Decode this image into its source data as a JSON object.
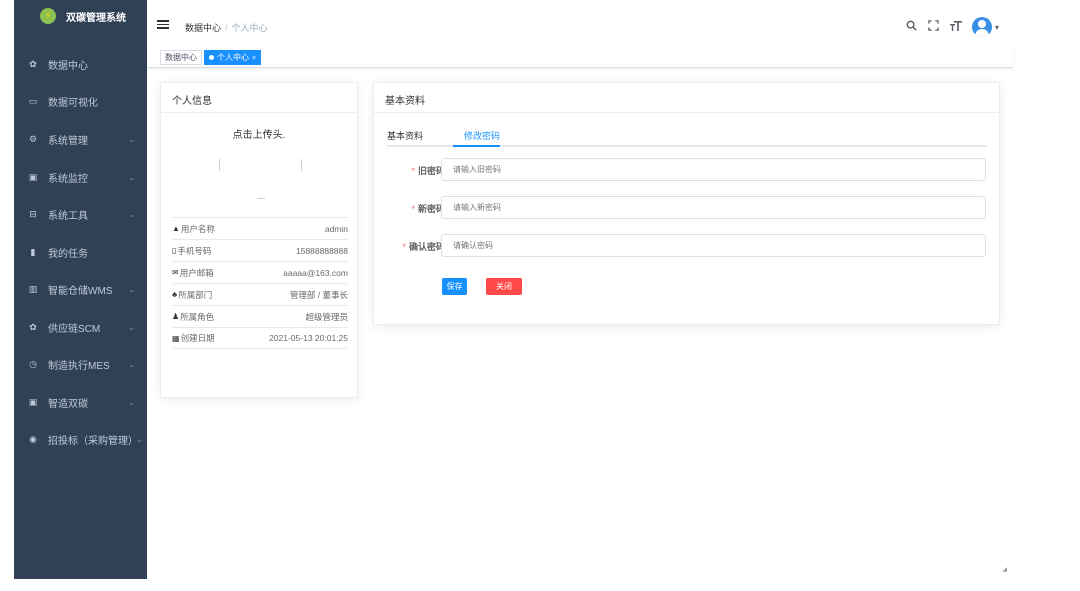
{
  "app": {
    "title": "双碳管理系统"
  },
  "sidebar": {
    "items": [
      {
        "label": "数据中心",
        "icon": "dashboard-icon",
        "glyph": "✿",
        "arrow": ""
      },
      {
        "label": "数据可视化",
        "icon": "monitor-icon",
        "glyph": "▭",
        "arrow": ""
      },
      {
        "label": "系统管理",
        "icon": "gear-icon",
        "glyph": "⚙",
        "arrow": "⌄"
      },
      {
        "label": "系统监控",
        "icon": "screen-icon",
        "glyph": "▣",
        "arrow": "⌄"
      },
      {
        "label": "系统工具",
        "icon": "toolbox-icon",
        "glyph": "⊟",
        "arrow": "⌄"
      },
      {
        "label": "我的任务",
        "icon": "task-icon",
        "glyph": "▮",
        "arrow": ""
      },
      {
        "label": "智能仓储WMS",
        "icon": "chart-icon",
        "glyph": "▥",
        "arrow": "⌄"
      },
      {
        "label": "供应链SCM",
        "icon": "dashboard-icon",
        "glyph": "✿",
        "arrow": "⌄"
      },
      {
        "label": "制造执行MES",
        "icon": "clock-icon",
        "glyph": "◷",
        "arrow": "⌄"
      },
      {
        "label": "智造双碳",
        "icon": "screen-icon",
        "glyph": "▣",
        "arrow": "⌄"
      },
      {
        "label": "招投标（采购管理）",
        "icon": "globe-icon",
        "glyph": "◉",
        "arrow": "⌄"
      }
    ]
  },
  "navbar": {
    "breadcrumb": [
      "数据中心",
      "个人中心"
    ],
    "separator": "/"
  },
  "tags": [
    {
      "label": "数据中心",
      "active": false
    },
    {
      "label": "个人中心",
      "active": true,
      "close": "×"
    }
  ],
  "info_card": {
    "title": "个人信息",
    "upload_text": "点击上传头.",
    "rows": [
      {
        "label": "用户名称",
        "value": "admin",
        "icon": "user-icon",
        "glyph": "👤"
      },
      {
        "label": "手机号码",
        "value": "15888888888",
        "icon": "phone-icon",
        "glyph": "▯"
      },
      {
        "label": "用户邮箱",
        "value": "aaaaa@163.com",
        "icon": "mail-icon",
        "glyph": "✉"
      },
      {
        "label": "所属部门",
        "value": "管理部 / 董事长",
        "icon": "tree-icon",
        "glyph": "品"
      },
      {
        "label": "所属角色",
        "value": "超级管理员",
        "icon": "peoples-icon",
        "glyph": "👥"
      },
      {
        "label": "创建日期",
        "value": "2021-05-13 20:01:25",
        "icon": "date-icon",
        "glyph": "▦"
      }
    ]
  },
  "basic_card": {
    "title": "基本资料",
    "tabs": [
      "基本资料",
      "修改密码"
    ],
    "active_tab": 1,
    "fields": [
      {
        "label": "旧密码",
        "placeholder": "请输入旧密码",
        "value": ""
      },
      {
        "label": "新密码",
        "placeholder": "请输入新密码",
        "value": ""
      },
      {
        "label": "确认密码",
        "placeholder": "请确认密码",
        "value": ""
      }
    ],
    "required_mark": "*",
    "save_label": "保存",
    "close_label": "关闭"
  },
  "colors": {
    "sidebar": "#304156",
    "primary": "#1890ff",
    "danger": "#ff4949"
  }
}
